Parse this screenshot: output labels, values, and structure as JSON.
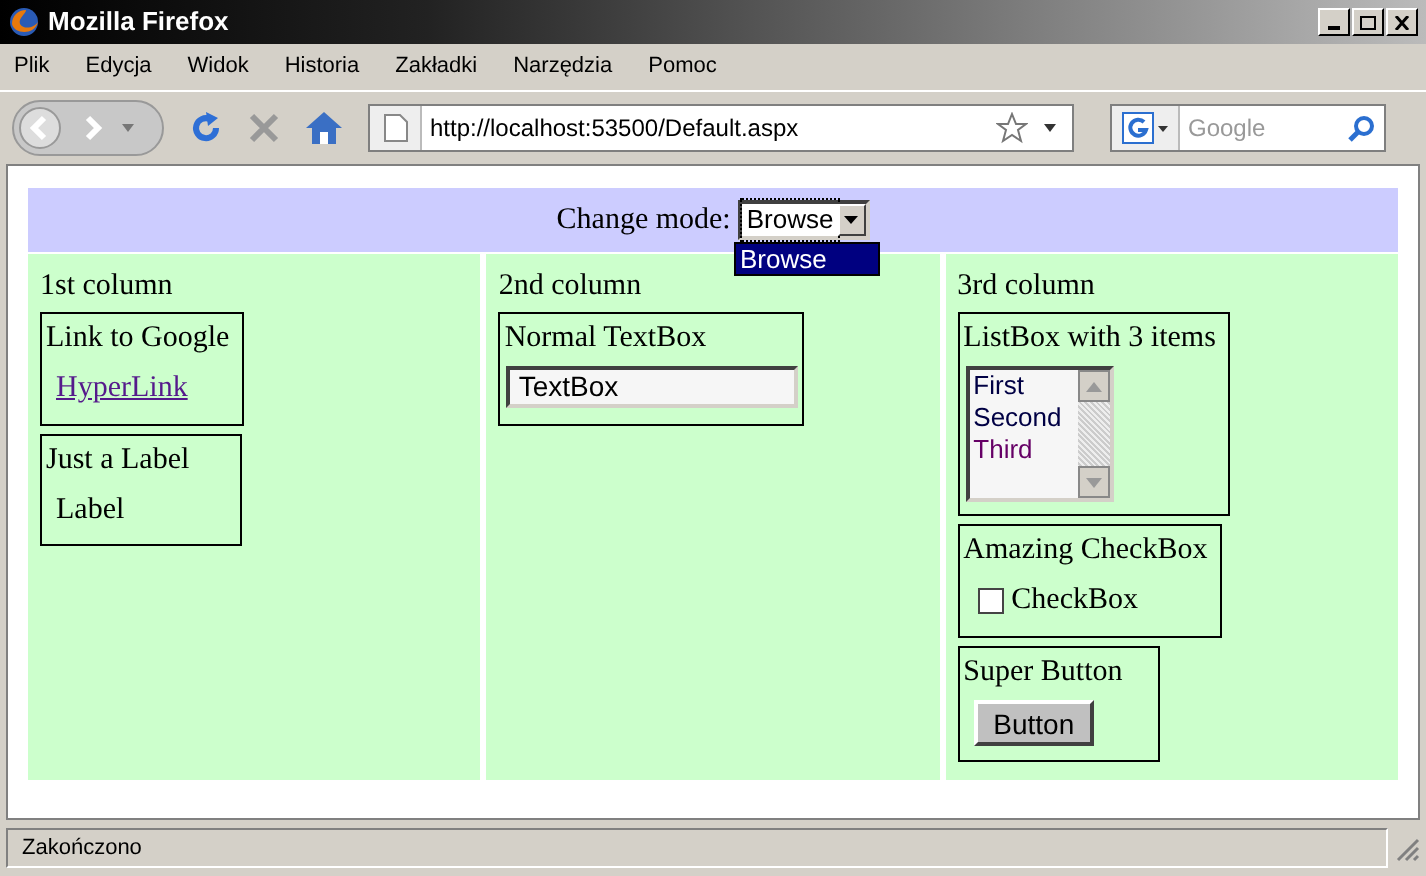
{
  "window": {
    "title": "Mozilla Firefox"
  },
  "menu": [
    "Plik",
    "Edycja",
    "Widok",
    "Historia",
    "Zakładki",
    "Narzędzia",
    "Pomoc"
  ],
  "address": {
    "value": "http://localhost:53500/Default.aspx"
  },
  "search": {
    "placeholder": "Google"
  },
  "mode_bar": {
    "label": "Change mode:",
    "value": "Browse",
    "expanded": true,
    "options": [
      {
        "label": "Browse",
        "selected": true
      }
    ]
  },
  "columns": [
    {
      "heading": "1st column",
      "panels": [
        {
          "kind": "hyperlink",
          "title": "Link to Google",
          "text": "HyperLink"
        },
        {
          "kind": "label",
          "title": "Just a Label",
          "text": "Label"
        }
      ]
    },
    {
      "heading": "2nd column",
      "panels": [
        {
          "kind": "textbox",
          "title": "Normal TextBox",
          "text": "TextBox"
        }
      ]
    },
    {
      "heading": "3rd column",
      "panels": [
        {
          "kind": "listbox",
          "title": "ListBox with 3 items",
          "items": [
            "First",
            "Second",
            "Third"
          ]
        },
        {
          "kind": "checkbox",
          "title": "Amazing CheckBox",
          "text": "CheckBox",
          "checked": false
        },
        {
          "kind": "button",
          "title": "Super Button",
          "text": "Button"
        }
      ]
    }
  ],
  "status_bar": {
    "text": "Zakończono"
  }
}
